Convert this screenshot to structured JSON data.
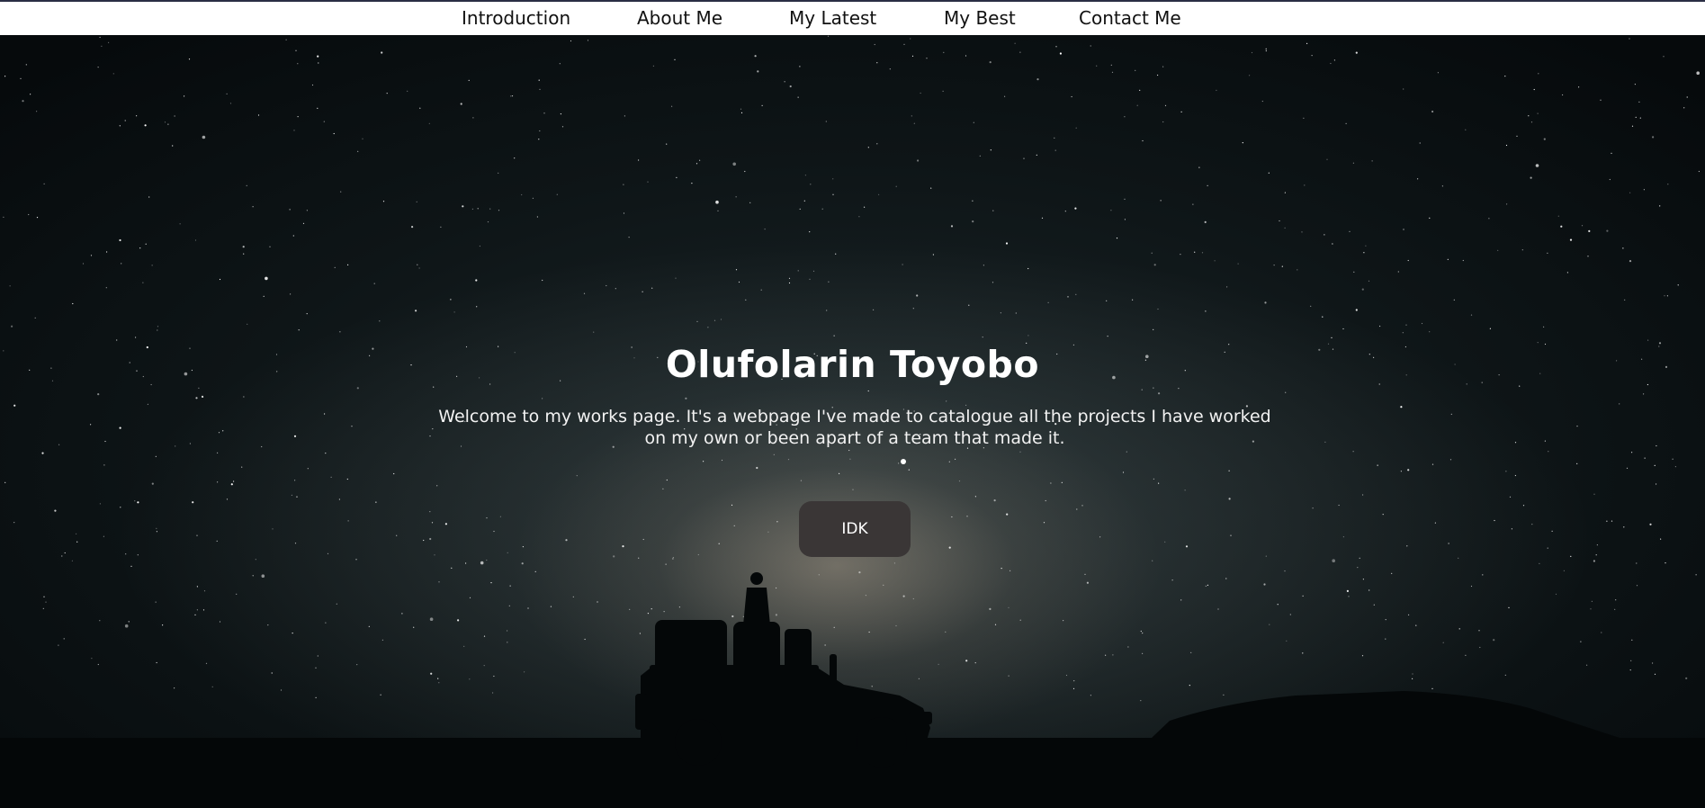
{
  "nav": {
    "items": [
      {
        "label": "Introduction"
      },
      {
        "label": "About Me"
      },
      {
        "label": "My Latest"
      },
      {
        "label": "My Best"
      },
      {
        "label": "Contact Me"
      }
    ]
  },
  "hero": {
    "title": "Olufolarin Toyobo",
    "description": "Welcome to my works page. It's a webpage I've made to catalogue all the projects I have worked on my own or been apart of a team that made it.",
    "button_label": "IDK",
    "background_image": "night-sky-milky-way-with-person-standing-on-jeep"
  },
  "colors": {
    "nav_background": "#ffffff",
    "nav_text": "#111111",
    "button_background": "#3a3636",
    "hero_text": "#ffffff"
  }
}
